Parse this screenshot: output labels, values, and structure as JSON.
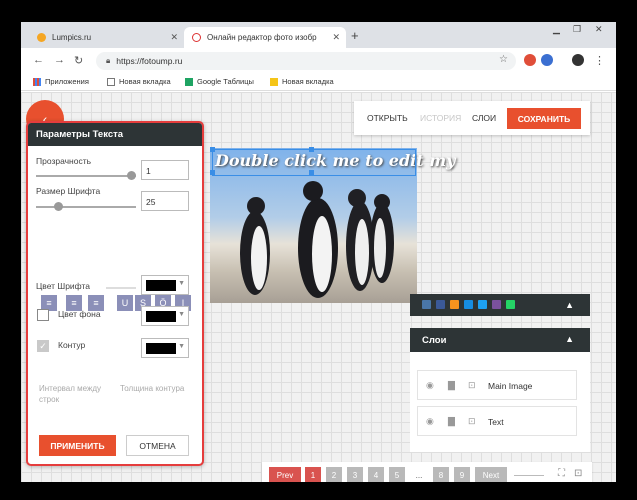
{
  "browser": {
    "tabs": [
      {
        "title": "Lumpics.ru"
      },
      {
        "title": "Онлайн редактор фото изобр"
      }
    ],
    "url": "https://fotoump.ru",
    "bookmarks": [
      "Приложения",
      "Новая вкладка",
      "Google Таблицы",
      "Новая вкладка"
    ]
  },
  "toolbar": {
    "open_label": "ОТКРЫТЬ",
    "history_label": "ИСТОРИЯ",
    "layers_label": "СЛОИ",
    "save_label": "СОХРАНИТЬ"
  },
  "canvas": {
    "text": "Double click me to edit my"
  },
  "text_panel": {
    "title": "Параметры Текста",
    "opacity_label": "Прозрачность",
    "opacity_value": "1",
    "opacity_level": 1.0,
    "font_size_label": "Размер Шрифта",
    "font_size_value": "25",
    "format_buttons": [
      "≡",
      "≡",
      "≡",
      "U",
      "S",
      "Ö",
      "I"
    ],
    "font_color_label": "Цвет Шрифта",
    "font_color": "#000000",
    "bg_color_label": "Цвет фона",
    "bg_color_checked": false,
    "bg_color": "#000000",
    "outline_label": "Контур",
    "outline_checked": true,
    "outline_color": "#000000",
    "line_spacing_label": "Интервал между строк",
    "outline_width_label": "Толщина контура",
    "apply_label": "ПРИМЕНИТЬ",
    "cancel_label": "ОТМЕНА"
  },
  "layers": {
    "title": "Слои",
    "items": [
      {
        "name": "Main Image"
      },
      {
        "name": "Text"
      }
    ]
  },
  "pagination": {
    "prev_label": "Prev",
    "pages": [
      "1",
      "2",
      "3",
      "4",
      "5"
    ],
    "ellipsis": "...",
    "tail_pages": [
      "8",
      "9"
    ],
    "next_label": "Next",
    "active_page": "1"
  },
  "colors": {
    "accent": "#e8502e",
    "dark": "#2d3436",
    "panel_border": "#e53d3d"
  }
}
